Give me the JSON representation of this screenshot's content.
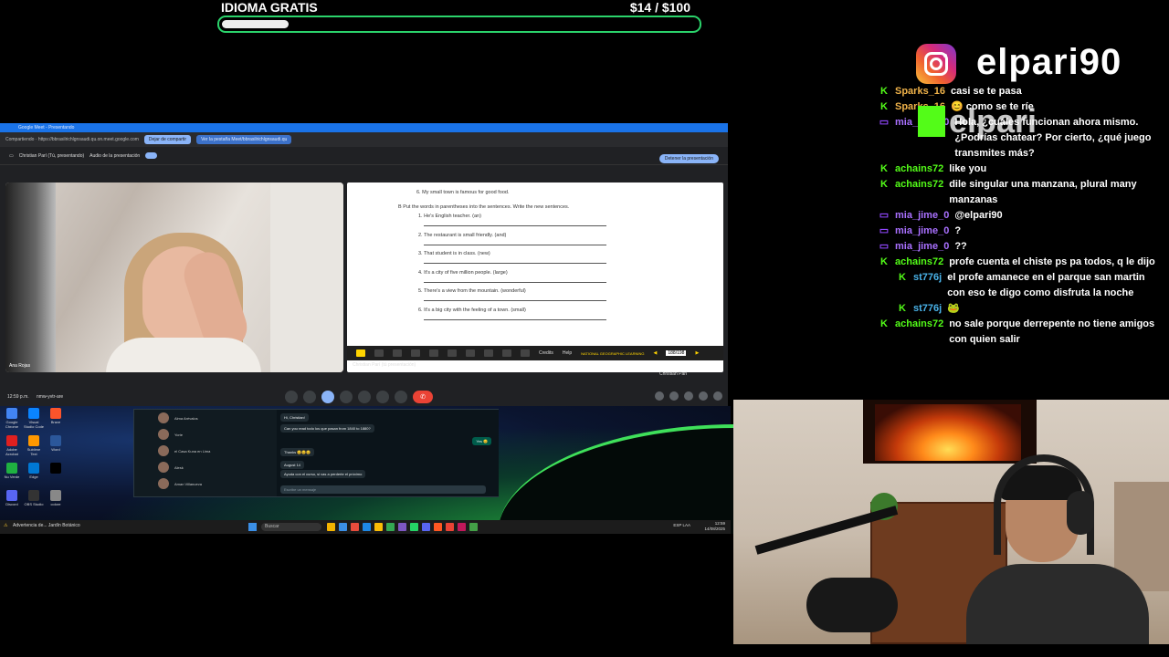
{
  "goal": {
    "title": "IDIOMA GRATIS",
    "amount": "$14   / $100",
    "progress": 0.14
  },
  "brand": {
    "icon": "instagram-icon",
    "handle": "elpari90",
    "watermark": "elpari"
  },
  "chat": {
    "messages": [
      {
        "badge": "K",
        "user": "Sparks_16",
        "text": "casi se te pasa"
      },
      {
        "badge": "K",
        "user": "Sparks_16",
        "text": "😊 como se te ríe"
      },
      {
        "badge": "T",
        "user": "mia_jime_0",
        "text": "Hola, ¿cuáles funcionan ahora mismo. ¿Podrías chatear? Por cierto, ¿qué juego transmites más?"
      },
      {
        "badge": "K",
        "user": "achains72",
        "text": "like you"
      },
      {
        "badge": "K",
        "user": "achains72",
        "text": "dile singular una manzana, plural many manzanas"
      },
      {
        "badge": "T",
        "user": "mia_jime_0",
        "text": "@elpari90"
      },
      {
        "badge": "T",
        "user": "mia_jime_0",
        "text": "?"
      },
      {
        "badge": "T",
        "user": "mia_jime_0",
        "text": "??"
      },
      {
        "badge": "K",
        "user": "achains72",
        "text": "profe cuenta el chiste ps pa todos, q le dijo"
      },
      {
        "badge": "K",
        "user": "st776j",
        "text": "el profe amanece en el parque san martin con eso te digo como disfruta la noche"
      },
      {
        "badge": "K",
        "user": "st776j",
        "text": "🐸"
      },
      {
        "badge": "K",
        "user": "achains72",
        "text": "no sale porque derrepente no tiene amigos con quien salir"
      }
    ]
  },
  "meet": {
    "chrome_title": "Google Meet - Presentando",
    "share_bar_text": "Compartiendo · https://bbrasilrichlgnsaudi.qu.on.meet.google.com",
    "share_pill_1": "Dejar de compartir",
    "share_pill_2": "Ver la pestaña Meet/bbrasilrichlgnsaudi.qu",
    "presenter": "Christian Parí (Tú, presentando)",
    "audio_label": "Audio de la presentación",
    "stop_button": "Detener la presentación",
    "cam_label": "Ana Rojas",
    "doc": {
      "top_line": "6.  My small town is famous for good food.",
      "instruction": "B   Put the words in parentheses into the sentences. Write the new sentences.",
      "items": [
        "1.  He's English teacher. (an)",
        "2.  The restaurant is small friendly. (and)",
        "3.  That student is in class. (new)",
        "4.  It's a city of five million people. (large)",
        "5.  There's a view from the mountain. (wonderful)",
        "6.  It's a big city with the feeling of a town. (small)"
      ]
    },
    "toolbar_credits": "Credits",
    "toolbar_help": "Help",
    "toolbar_brand": "NATIONAL GEOGRAPHIC LEARNING",
    "page_number": "188/198",
    "share_label": "Christian Parí (tú presentación)",
    "presenter_small": "Christian Parí",
    "time": "12:59 p.m.",
    "meeting_code": "nmw-yvtr-are"
  },
  "desktop": {
    "icons": [
      "Google Chrome",
      "Visual Studio Code",
      "Brave",
      "Adobe Acrobat",
      "Sublime Text",
      "Word",
      "Nu Verde",
      "Edge",
      "",
      "Discord",
      "OBS Studio",
      "colore"
    ],
    "whatsapp_contacts": [
      {
        "name": "Alma Arévalos",
        "preview": "Ok"
      },
      {
        "name": "Yorie",
        "preview": "Sí, solo unas preguntas"
      },
      {
        "name": "el Casa Kuna en Lima",
        "preview": "Sí, hola a todos"
      },
      {
        "name": "Alesk",
        "preview": "Gracias Profe"
      },
      {
        "name": "Aman Villanueva",
        "preview": ""
      }
    ],
    "whatsapp_messages": [
      {
        "text": "Hi, Christian!",
        "me": false
      },
      {
        "text": "Can you read todo los que pasan from 1840 to 1880?",
        "me": false
      },
      {
        "text": "Yes 😊",
        "me": true
      },
      {
        "text": "Thanks 😊😊😊",
        "me": false
      },
      {
        "text": "August 14",
        "me": false
      },
      {
        "text": "Ayuda con el curso, si vas a perderte el próximo",
        "me": false
      }
    ],
    "whatsapp_input": "Escribe un mensaje"
  },
  "taskbar": {
    "warning_icon": "warning-icon",
    "warning_text": "Advertencia de... Jardín Botánico",
    "search_placeholder": "Buscar",
    "clock_time": "12:59",
    "clock_date": "14/08/2025",
    "lang": "ESP LAA"
  },
  "colors": {
    "accent_green": "#53fc18",
    "twitch_purple": "#9147ff",
    "goal_border": "#2bd36b",
    "meet_blue": "#8ab4f8"
  }
}
